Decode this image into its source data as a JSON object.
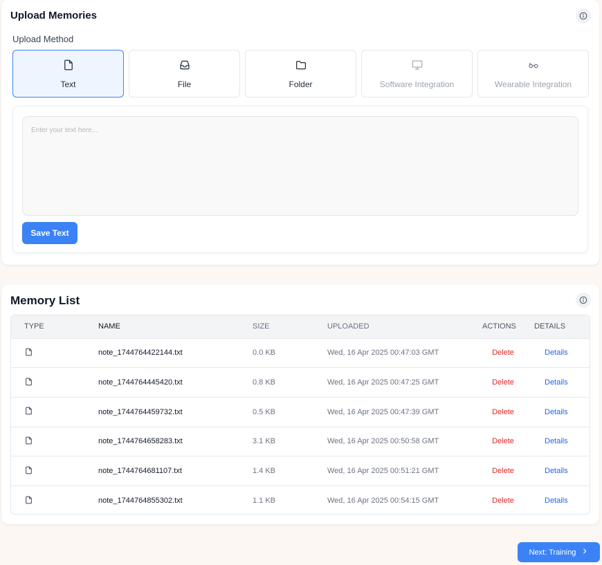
{
  "upload": {
    "title": "Upload Memories",
    "method_label": "Upload Method",
    "methods": [
      {
        "label": "Text",
        "icon": "document-icon",
        "state": "active"
      },
      {
        "label": "File",
        "icon": "inbox-icon",
        "state": "enabled"
      },
      {
        "label": "Folder",
        "icon": "folder-icon",
        "state": "enabled"
      },
      {
        "label": "Software Integration",
        "icon": "monitor-icon",
        "state": "disabled"
      },
      {
        "label": "Wearable Integration",
        "icon": "glasses-icon",
        "state": "disabled"
      }
    ],
    "text_value": "",
    "text_placeholder": "Enter your text here...",
    "save_label": "Save Text"
  },
  "memory_list": {
    "title": "Memory List",
    "columns": [
      "Type",
      "Name",
      "Size",
      "Uploaded",
      "Actions",
      "Details"
    ],
    "rows": [
      {
        "type_icon": "file-icon",
        "name": "note_1744764422144.txt",
        "size": "0.0 KB",
        "uploaded": "Wed, 16 Apr 2025 00:47:03 GMT",
        "action": "Delete",
        "details": "Details"
      },
      {
        "type_icon": "file-icon",
        "name": "note_1744764445420.txt",
        "size": "0.8 KB",
        "uploaded": "Wed, 16 Apr 2025 00:47:25 GMT",
        "action": "Delete",
        "details": "Details"
      },
      {
        "type_icon": "file-icon",
        "name": "note_1744764459732.txt",
        "size": "0.5 KB",
        "uploaded": "Wed, 16 Apr 2025 00:47:39 GMT",
        "action": "Delete",
        "details": "Details"
      },
      {
        "type_icon": "file-icon",
        "name": "note_1744764658283.txt",
        "size": "3.1 KB",
        "uploaded": "Wed, 16 Apr 2025 00:50:58 GMT",
        "action": "Delete",
        "details": "Details"
      },
      {
        "type_icon": "file-icon",
        "name": "note_1744764681107.txt",
        "size": "1.4 KB",
        "uploaded": "Wed, 16 Apr 2025 00:51:21 GMT",
        "action": "Delete",
        "details": "Details"
      },
      {
        "type_icon": "file-icon",
        "name": "note_1744764855302.txt",
        "size": "1.1 KB",
        "uploaded": "Wed, 16 Apr 2025 00:54:15 GMT",
        "action": "Delete",
        "details": "Details"
      }
    ]
  },
  "footer": {
    "next_label": "Next: Training"
  },
  "colors": {
    "accent": "#3b82f6",
    "delete": "#dc2626",
    "link": "#2563eb",
    "page_bg": "#fcf7f3"
  }
}
